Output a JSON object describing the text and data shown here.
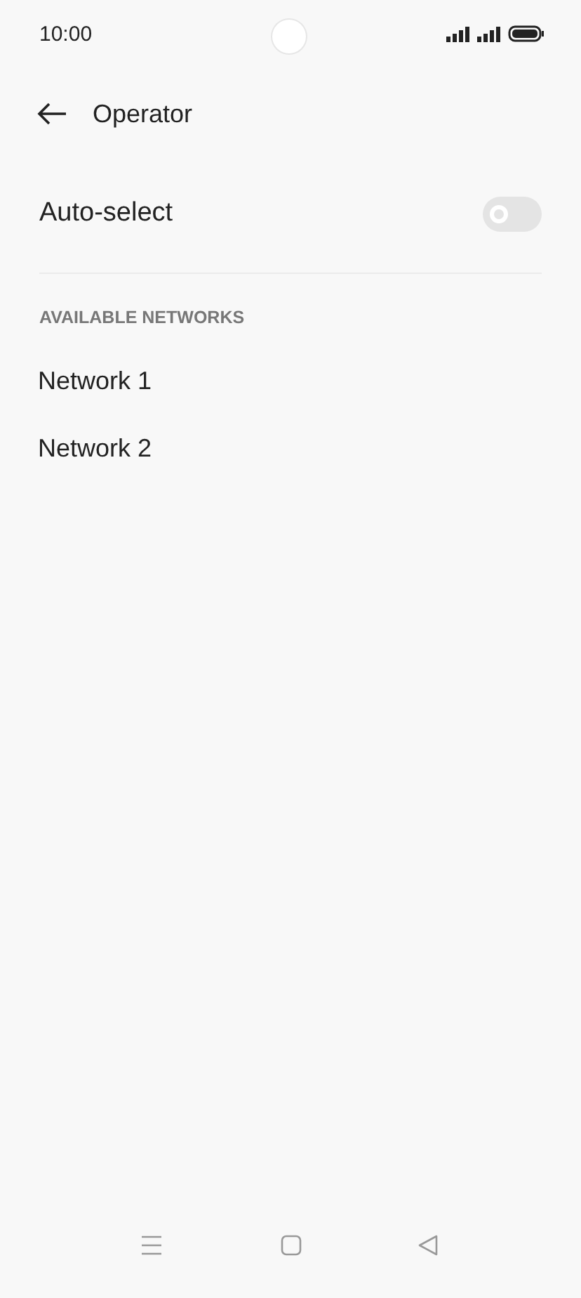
{
  "status_bar": {
    "time": "10:00"
  },
  "header": {
    "title": "Operator"
  },
  "auto_select": {
    "label": "Auto-select",
    "on": false
  },
  "section": {
    "title": "AVAILABLE NETWORKS"
  },
  "networks": [
    {
      "name": "Network 1"
    },
    {
      "name": "Network 2"
    }
  ]
}
